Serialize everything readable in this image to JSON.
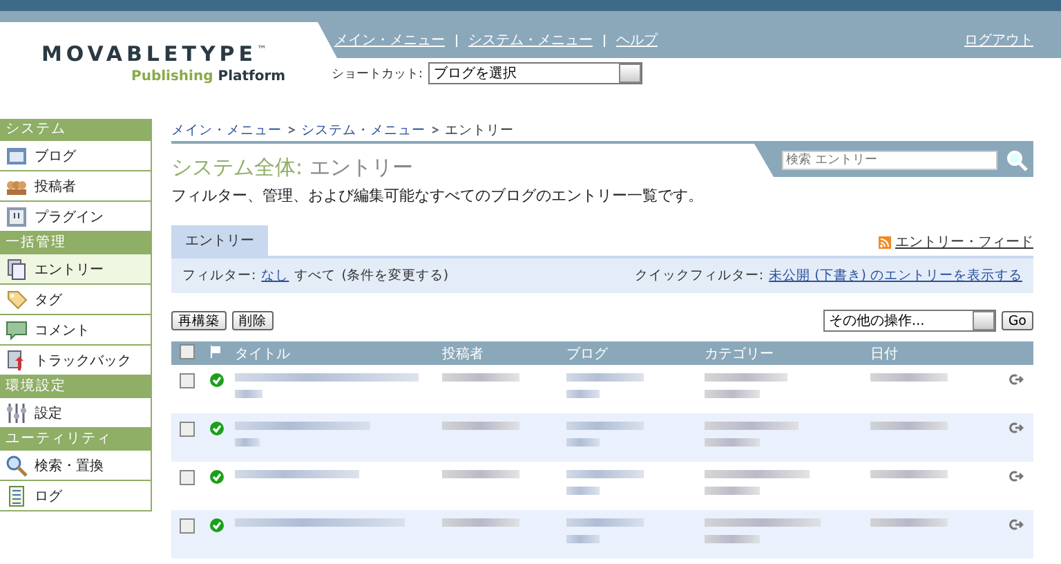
{
  "header": {
    "logo_main": "MOVABLETYPE",
    "logo_tm": "™",
    "logo_sub1": "Publishing",
    "logo_sub2": "Platform",
    "nav": [
      "メイン・メニュー",
      "システム・メニュー",
      "ヘルプ"
    ],
    "logout": "ログアウト",
    "shortcut_label": "ショートカット:",
    "shortcut_value": "ブログを選択"
  },
  "sidebar": [
    {
      "heading": "システム",
      "items": [
        {
          "label": "ブログ",
          "selected": false
        },
        {
          "label": "投稿者",
          "selected": false
        },
        {
          "label": "プラグイン",
          "selected": false
        }
      ]
    },
    {
      "heading": "一括管理",
      "items": [
        {
          "label": "エントリー",
          "selected": true
        },
        {
          "label": "タグ",
          "selected": false
        },
        {
          "label": "コメント",
          "selected": false
        },
        {
          "label": "トラックバック",
          "selected": false
        }
      ]
    },
    {
      "heading": "環境設定",
      "items": [
        {
          "label": "設定",
          "selected": false
        }
      ]
    },
    {
      "heading": "ユーティリティ",
      "items": [
        {
          "label": "検索・置換",
          "selected": false
        },
        {
          "label": "ログ",
          "selected": false
        }
      ]
    }
  ],
  "breadcrumb": [
    "メイン・メニュー",
    "システム・メニュー",
    "エントリー"
  ],
  "search": {
    "placeholder": "検索 エントリー"
  },
  "title_scope": "システム全体:",
  "title": "エントリー",
  "description": "フィルター、管理、および編集可能なすべてのブログのエントリー一覧です。",
  "tabs": [
    {
      "label": "エントリー",
      "selected": true
    }
  ],
  "feed_link": "エントリー・フィード",
  "filter": {
    "label": "フィルター:",
    "value": "なし",
    "text": "すべて",
    "change": "(条件を変更する)",
    "quick_label": "クイックフィルター:",
    "quick_link": "未公開 (下書き) のエントリーを表示する"
  },
  "buttons": [
    "再構築",
    "削除"
  ],
  "actions": {
    "value": "その他の操作...",
    "go": "Go"
  },
  "table": {
    "columns": [
      "タイトル",
      "投稿者",
      "ブログ",
      "カテゴリー",
      "日付"
    ],
    "all_checked": false,
    "rows": [
      {
        "checked": false,
        "published": true
      },
      {
        "checked": false,
        "published": true
      },
      {
        "checked": false,
        "published": true
      },
      {
        "checked": false,
        "published": true
      }
    ]
  }
}
